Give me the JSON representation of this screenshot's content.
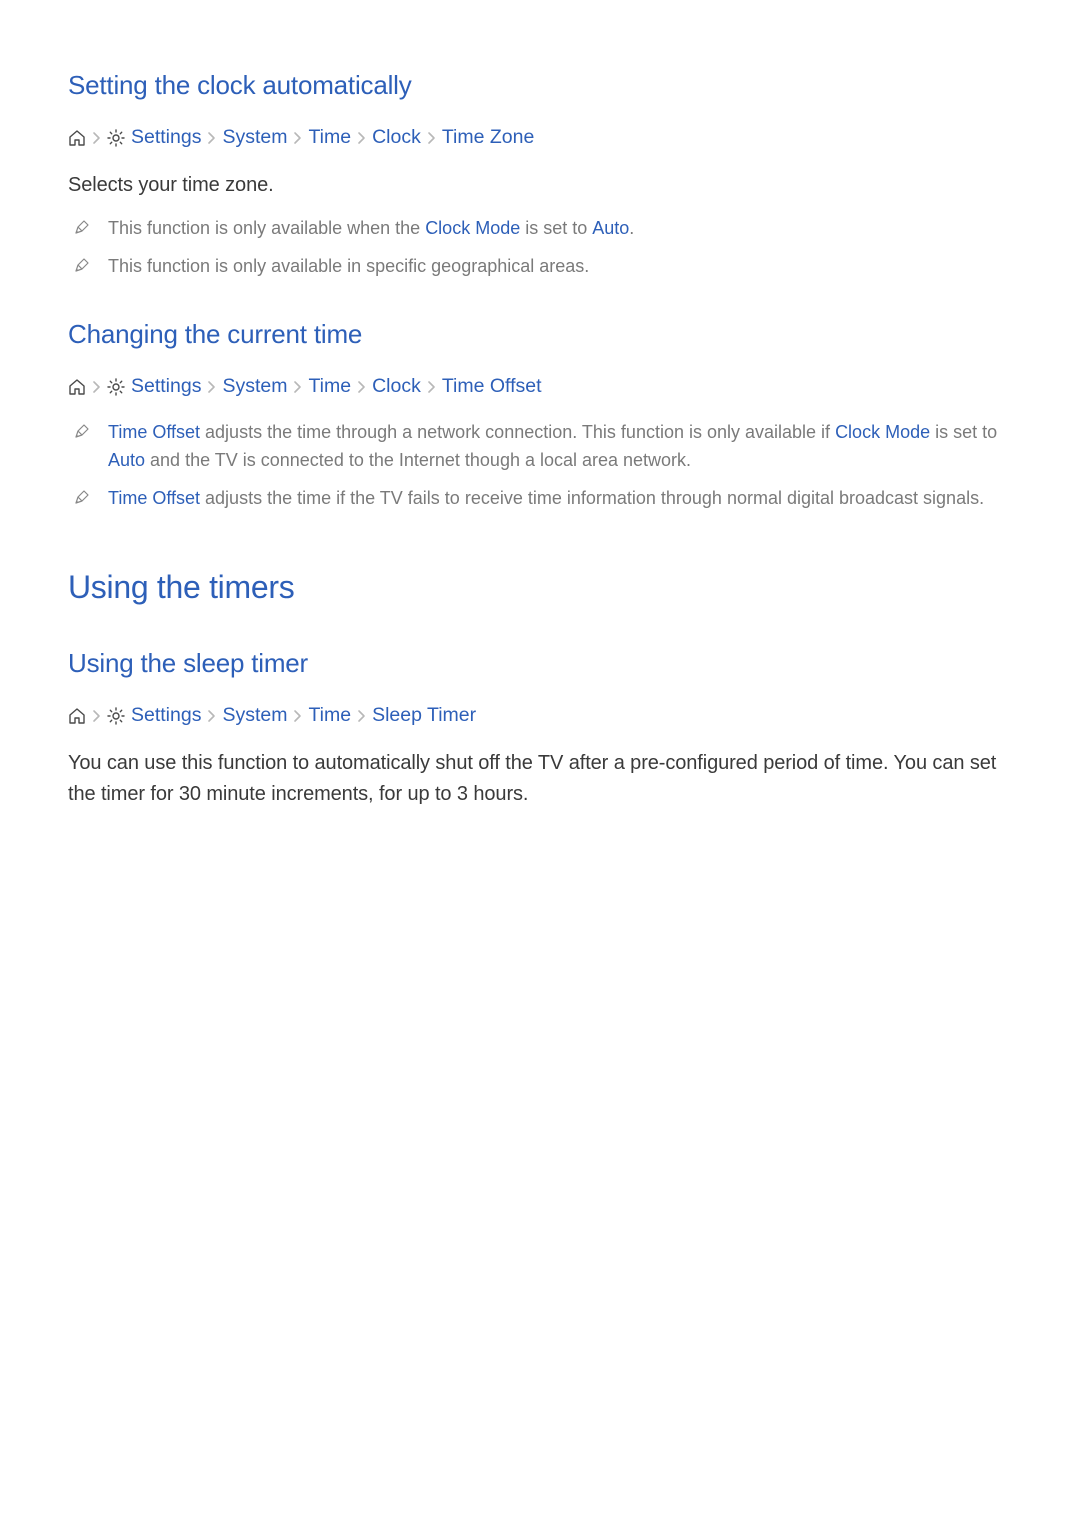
{
  "s1": {
    "heading": "Setting the clock automatically",
    "crumbs": [
      "Settings",
      "System",
      "Time",
      "Clock",
      "Time Zone"
    ],
    "body": "Selects your time zone.",
    "notes": [
      {
        "pre": "This function is only available when the ",
        "kw1": "Clock Mode",
        "mid": " is set to ",
        "kw2": "Auto",
        "post": "."
      },
      {
        "pre": "This function is only available in specific geographical areas.",
        "kw1": "",
        "mid": "",
        "kw2": "",
        "post": ""
      }
    ]
  },
  "s2": {
    "heading": "Changing the current time",
    "crumbs": [
      "Settings",
      "System",
      "Time",
      "Clock",
      "Time Offset"
    ],
    "notes": [
      {
        "kw0": "Time Offset",
        "t0": " adjusts the time through a network connection. This function is only available if ",
        "kw1": "Clock Mode",
        "t1": " is set to ",
        "kw2": "Auto",
        "t2": " and the TV is connected to the Internet though a local area network."
      },
      {
        "kw0": "Time Offset",
        "t0": " adjusts the time if the TV fails to receive time information through normal digital broadcast signals.",
        "kw1": "",
        "t1": "",
        "kw2": "",
        "t2": ""
      }
    ]
  },
  "h1": "Using the timers",
  "s3": {
    "heading": "Using the sleep timer",
    "crumbs": [
      "Settings",
      "System",
      "Time",
      "Sleep Timer"
    ],
    "body": "You can use this function to automatically shut off the TV after a pre-configured period of time. You can set the timer for 30 minute increments, for up to 3 hours."
  }
}
